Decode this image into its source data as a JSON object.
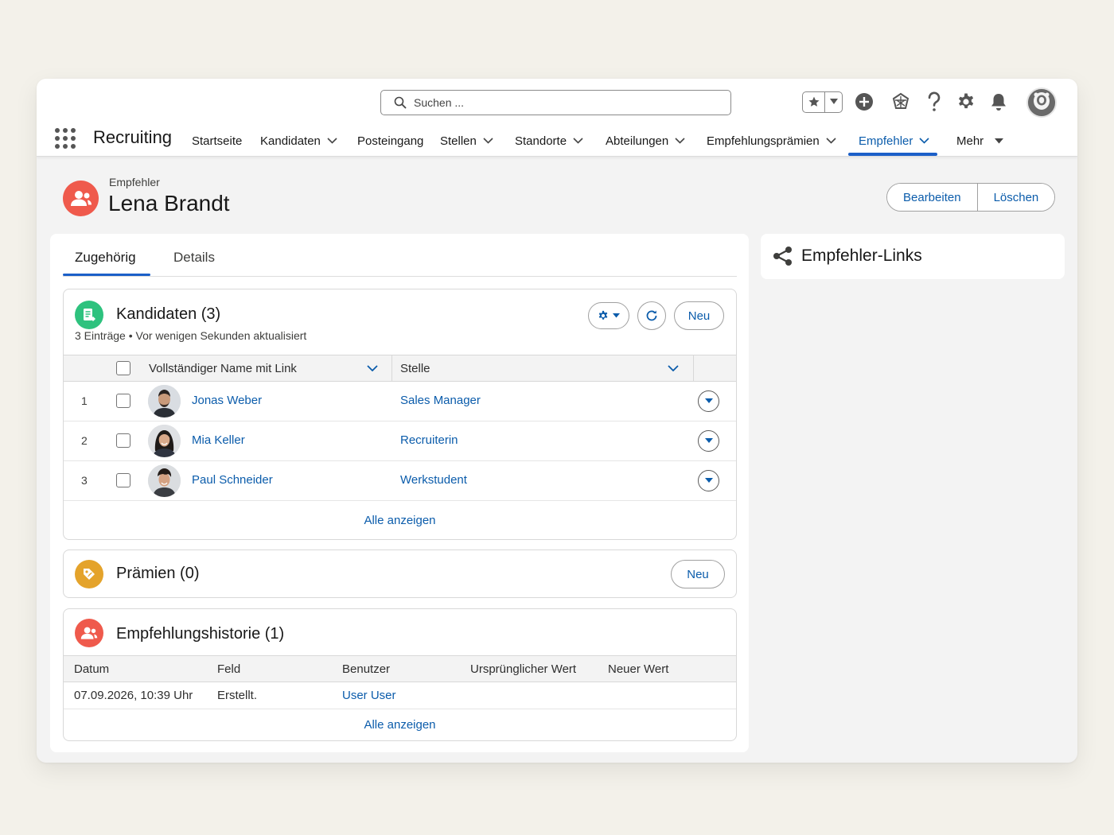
{
  "header": {
    "search_placeholder": "Suchen ..."
  },
  "nav": {
    "app_name": "Recruiting",
    "items": [
      {
        "label": "Startseite"
      },
      {
        "label": "Kandidaten"
      },
      {
        "label": "Posteingang"
      },
      {
        "label": "Stellen"
      },
      {
        "label": "Standorte"
      },
      {
        "label": "Abteilungen"
      },
      {
        "label": "Empfehlungsprämien"
      },
      {
        "label": "Empfehler"
      },
      {
        "label": "Mehr"
      }
    ],
    "active": "Empfehler"
  },
  "record": {
    "type": "Empfehler",
    "name": "Lena Brandt",
    "actions": {
      "edit": "Bearbeiten",
      "delete": "Löschen"
    }
  },
  "tabs": [
    {
      "label": "Zugehörig",
      "active": true
    },
    {
      "label": "Details",
      "active": false
    }
  ],
  "candidates": {
    "title": "Kandidaten (3)",
    "subtitle": "3 Einträge • Vor wenigen Sekunden aktualisiert",
    "new_label": "Neu",
    "columns": [
      "Vollständiger Name mit Link",
      "Stelle"
    ],
    "rows": [
      {
        "num": "1",
        "name": "Jonas Weber",
        "position": "Sales Manager"
      },
      {
        "num": "2",
        "name": "Mia Keller",
        "position": "Recruiterin"
      },
      {
        "num": "3",
        "name": "Paul Schneider",
        "position": "Werkstudent"
      }
    ],
    "view_all": "Alle anzeigen"
  },
  "rewards": {
    "title": "Prämien (0)",
    "new_label": "Neu"
  },
  "history": {
    "title": "Empfehlungshistorie (1)",
    "columns": [
      "Datum",
      "Feld",
      "Benutzer",
      "Ursprünglicher Wert",
      "Neuer Wert"
    ],
    "rows": [
      {
        "date": "07.09.2026, 10:39 Uhr",
        "field": "Erstellt.",
        "user": "User User",
        "old": "",
        "new": ""
      }
    ],
    "view_all": "Alle anzeigen"
  },
  "side": {
    "title": "Empfehler-Links"
  },
  "colors": {
    "accent": "#0b5cab",
    "candidates_icon": "#2ec27e",
    "rewards_icon": "#e4a32b",
    "history_icon": "#ef5a4c"
  }
}
